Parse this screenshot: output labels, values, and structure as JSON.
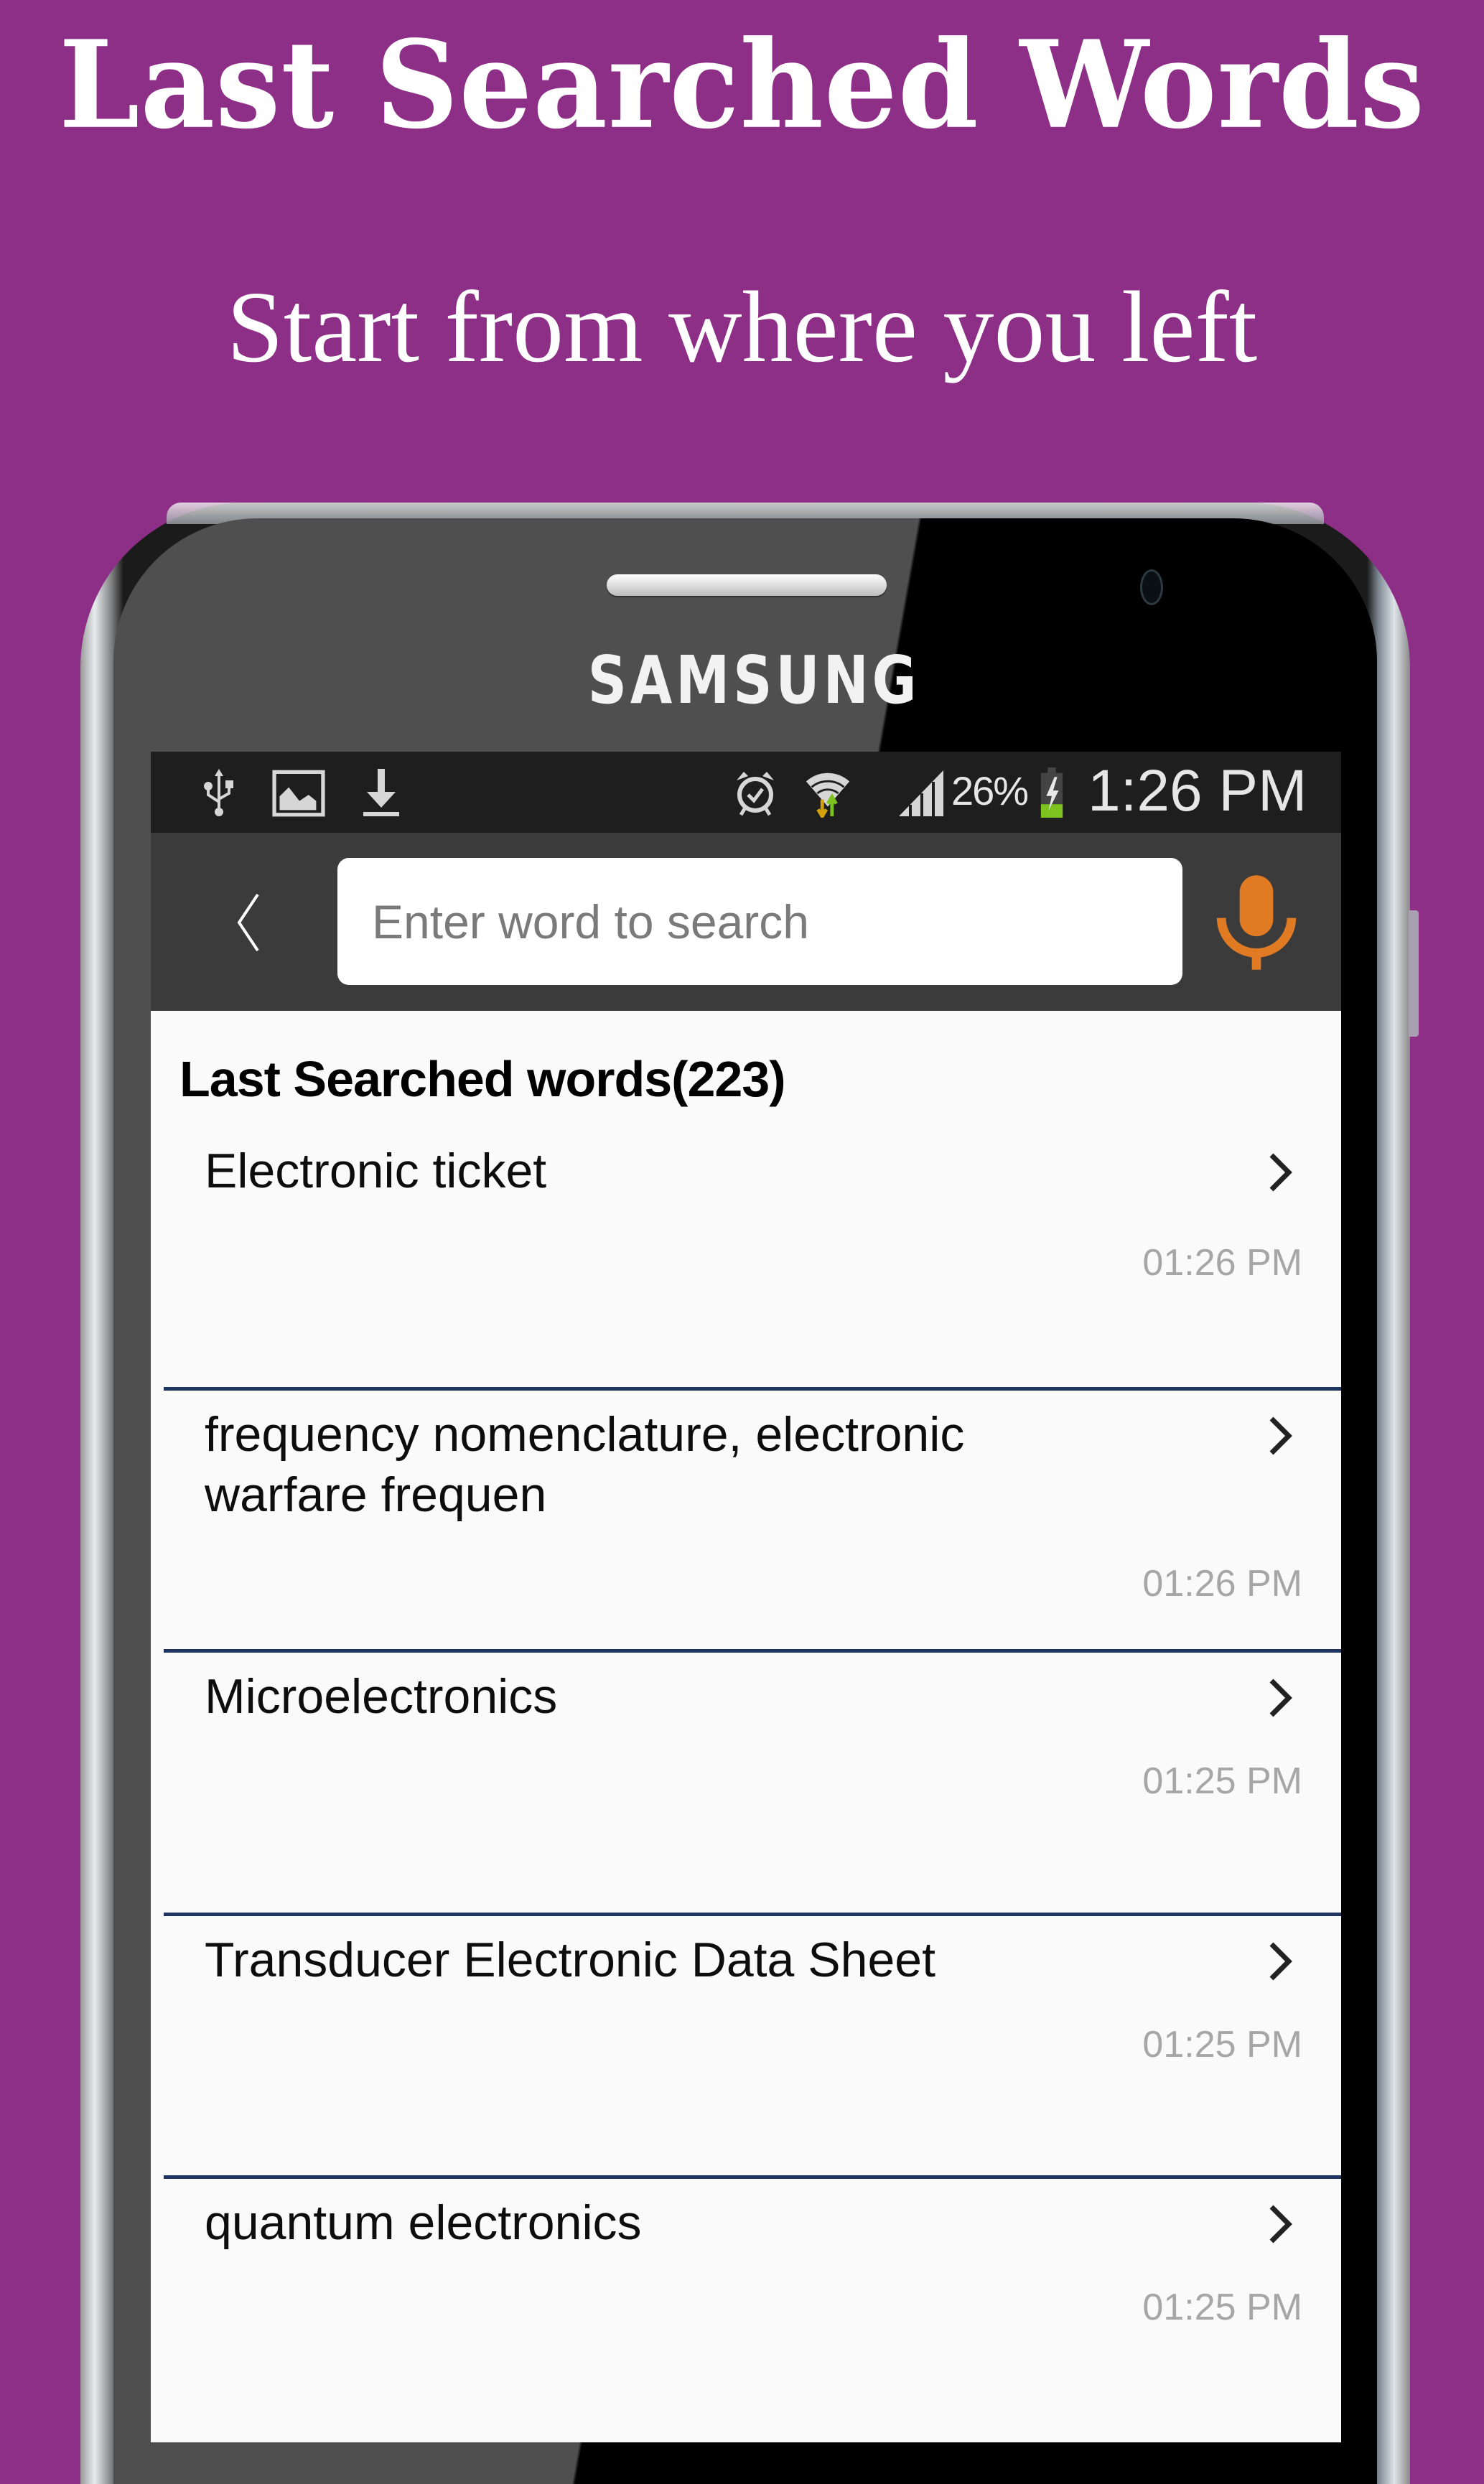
{
  "promo": {
    "title": "Last Searched Words",
    "subtitle": "Start from where you left",
    "background_color": "#8e2f87"
  },
  "device": {
    "brand": "SAMSUNG"
  },
  "status_bar": {
    "left_icons": [
      "usb-icon",
      "image-icon",
      "download-icon"
    ],
    "right_icons": [
      "alarm-icon",
      "wifi-icon",
      "signal-icon",
      "battery-charging-icon"
    ],
    "battery_percent": "26%",
    "battery_level": 0.26,
    "time": "1:26 PM"
  },
  "app_bar": {
    "back_icon": "chevron-left-icon",
    "search_placeholder": "Enter word to search",
    "search_value": "",
    "mic_icon": "microphone-icon",
    "accent_color": "#e07b24"
  },
  "list": {
    "header": "Last Searched words(223)",
    "items": [
      {
        "word": "Electronic ticket",
        "time": "01:26 PM"
      },
      {
        "word": "frequency nomenclature, electronic warfare frequen",
        "time": "01:26 PM"
      },
      {
        "word": "Microelectronics",
        "time": "01:25 PM"
      },
      {
        "word": "Transducer Electronic Data Sheet",
        "time": "01:25 PM"
      },
      {
        "word": "quantum electronics",
        "time": "01:25 PM"
      }
    ]
  }
}
